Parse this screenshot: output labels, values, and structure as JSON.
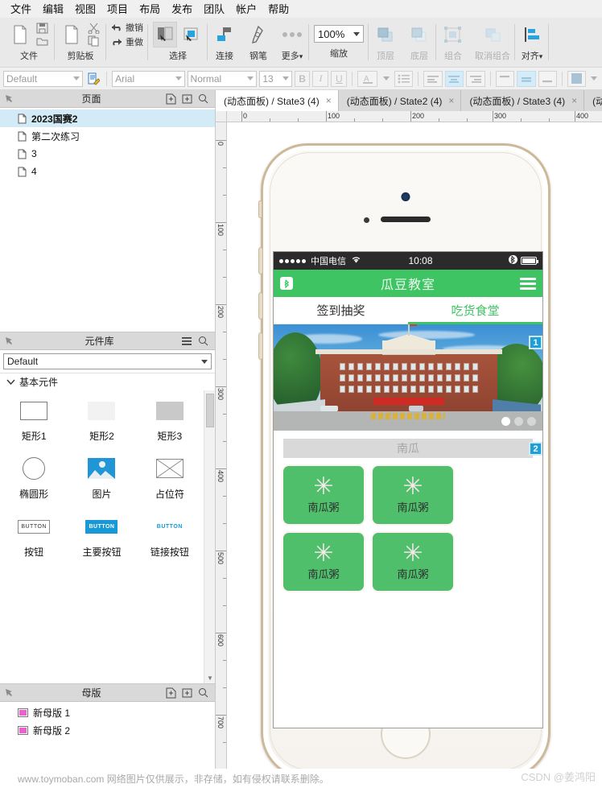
{
  "menubar": {
    "items": [
      "文件",
      "编辑",
      "视图",
      "项目",
      "布局",
      "发布",
      "团队",
      "帐户",
      "帮助"
    ]
  },
  "toolbar": {
    "groups": [
      {
        "label": "文件",
        "icons": [
          "new-file-icon",
          "save-icon",
          "open-folder-icon"
        ]
      },
      {
        "label": "剪贴板",
        "icons": [
          "cut-icon",
          "copy-icon",
          "paste-icon"
        ]
      },
      {
        "label": "",
        "undo": "撤销",
        "redo": "重做"
      },
      {
        "label": "选择",
        "icons": [
          "select-mode-icon",
          "connect-mode-icon"
        ]
      },
      {
        "label": "连接",
        "icons": [
          "connector-icon"
        ]
      },
      {
        "label": "钢笔",
        "icons": [
          "pen-icon"
        ]
      },
      {
        "label": "更多",
        "icons": [
          "more-dots-icon"
        ]
      },
      {
        "label": "缩放",
        "zoom_value": "100%"
      },
      {
        "label": "顶层",
        "icons": [
          "bring-to-front-icon"
        ]
      },
      {
        "label": "底层",
        "icons": [
          "send-to-back-icon"
        ]
      },
      {
        "label": "组合",
        "icons": [
          "group-icon"
        ]
      },
      {
        "label": "取消组合",
        "icons": [
          "ungroup-icon"
        ]
      },
      {
        "label": "对齐",
        "icons": [
          "align-icon"
        ]
      }
    ]
  },
  "formatbar": {
    "style_preset": "Default",
    "style_icon": "style-editor-icon",
    "font_family": "Arial",
    "font_weight": "Normal",
    "font_size": "13",
    "bold": "B",
    "italic": "I",
    "underline": "U",
    "text_color_icon": "font-color-icon",
    "bullet_icon": "bullet-list-icon",
    "align_left_icon": "align-left-icon",
    "align_center_icon": "align-center-icon",
    "align_right_icon": "align-right-icon",
    "valign_top_icon": "valign-top-icon",
    "valign_middle_icon": "valign-middle-icon",
    "valign_bottom_icon": "valign-bottom-icon",
    "fill_color": "#a8c4d4"
  },
  "pages_panel": {
    "title": "页面",
    "icons": [
      "add-page-icon",
      "add-folder-icon",
      "search-icon"
    ],
    "items": [
      {
        "label": "2023国赛2",
        "selected": true
      },
      {
        "label": "第二次练习",
        "selected": false
      },
      {
        "label": "3",
        "selected": false
      },
      {
        "label": "4",
        "selected": false
      }
    ]
  },
  "widget_library": {
    "title": "元件库",
    "icons": [
      "menu-icon",
      "search-icon"
    ],
    "selected_library": "Default",
    "section_label": "基本元件",
    "items": [
      {
        "label": "矩形1",
        "icon": "rectangle-outline-icon"
      },
      {
        "label": "矩形2",
        "icon": "rectangle-light-icon"
      },
      {
        "label": "矩形3",
        "icon": "rectangle-gray-icon"
      },
      {
        "label": "椭圆形",
        "icon": "ellipse-icon"
      },
      {
        "label": "图片",
        "icon": "image-icon"
      },
      {
        "label": "占位符",
        "icon": "placeholder-icon"
      },
      {
        "label": "按钮",
        "icon": "button-icon",
        "badge": "BUTTON"
      },
      {
        "label": "主要按钮",
        "icon": "primary-button-icon",
        "badge": "BUTTON"
      },
      {
        "label": "链接按钮",
        "icon": "link-button-icon",
        "badge": "BUTTON"
      }
    ]
  },
  "masters_panel": {
    "title": "母版",
    "icons": [
      "add-master-icon",
      "add-folder-icon",
      "search-icon"
    ],
    "items": [
      {
        "label": "新母版 1"
      },
      {
        "label": "新母版 2"
      }
    ]
  },
  "tabs": [
    {
      "label": "(动态面板) / State3 (4)",
      "active": true,
      "close": "×"
    },
    {
      "label": "(动态面板) / State2 (4)",
      "active": false,
      "close": "×"
    },
    {
      "label": "(动态面板) / State3 (4)",
      "active": false,
      "close": "×"
    },
    {
      "label": "(动态",
      "active": false,
      "close": ""
    }
  ],
  "rulers": {
    "horizontal_labels": [
      "0",
      "100",
      "200",
      "300",
      "400"
    ],
    "vertical_labels": [
      "0",
      "100",
      "200",
      "300",
      "400",
      "500",
      "600",
      "700"
    ]
  },
  "phone_preview": {
    "statusbar": {
      "signal_dots": 5,
      "carrier": "中国电信",
      "wifi_icon": "wifi-icon",
      "time": "10:08",
      "bluetooth_icon": "bluetooth-icon",
      "battery_icon": "battery-full-icon"
    },
    "app_header": {
      "left_icon": "bluetooth-icon",
      "title": "瓜豆教室",
      "menu_icon": "hamburger-menu-icon"
    },
    "app_tabs": [
      {
        "label": "签到抽奖",
        "active": false
      },
      {
        "label": "吃货食堂",
        "active": true
      }
    ],
    "carousel": {
      "alt": "campus-building-photo",
      "dot_count": 3,
      "active_dot": 0
    },
    "search_placeholder": "南瓜",
    "cards": [
      {
        "label": "南瓜粥",
        "icon": "flower-asterisk-icon"
      },
      {
        "label": "南瓜粥",
        "icon": "flower-asterisk-icon"
      },
      {
        "label": "南瓜粥",
        "icon": "flower-asterisk-icon"
      },
      {
        "label": "南瓜粥",
        "icon": "flower-asterisk-icon"
      }
    ],
    "footnote_badges": [
      "1",
      "2"
    ]
  },
  "watermark": {
    "left": "www.toymoban.com 网络图片仅供展示，非存储，如有侵权请联系删除。",
    "right": "CSDN @姜鸿阳"
  },
  "colors": {
    "app_green": "#3fc463",
    "card_green": "#4fbf6b",
    "badge_blue": "#1f9fd8",
    "selection_blue": "#d3eaf7"
  }
}
